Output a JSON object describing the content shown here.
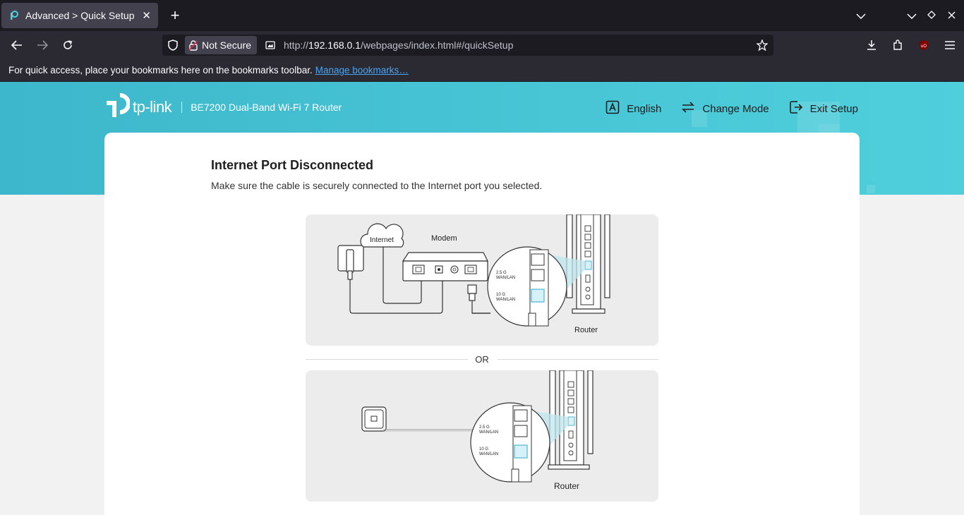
{
  "browser": {
    "tab_title": "Advanced > Quick Setup",
    "not_secure": "Not Secure",
    "url_prefix": "http://",
    "url_host": "192.168.0.1",
    "url_path": "/webpages/index.html#/quickSetup",
    "bookmarks_text": "For quick access, place your bookmarks here on the bookmarks toolbar.",
    "bookmarks_link": "Manage bookmarks…"
  },
  "header": {
    "brand": "tp-link",
    "model": "BE7200 Dual-Band Wi-Fi 7 Router",
    "language": "English",
    "change_mode": "Change Mode",
    "exit_setup": "Exit Setup"
  },
  "content": {
    "title": "Internet Port Disconnected",
    "description": "Make sure the cable is securely connected to the Internet port you selected.",
    "or_label": "OR",
    "diagram1": {
      "internet": "Internet",
      "modem": "Modem",
      "port1": [
        "2.5 G",
        "WAN/LAN"
      ],
      "port2": [
        "10 G",
        "WAN/LAN"
      ],
      "router": "Router"
    },
    "diagram2": {
      "port1": [
        "2.5 G",
        "WAN/LAN"
      ],
      "port2": [
        "10 G",
        "WAN/LAN"
      ],
      "router": "Router"
    }
  },
  "colors": {
    "accent": "#48c6d6",
    "highlight": "#4bb8d2"
  }
}
